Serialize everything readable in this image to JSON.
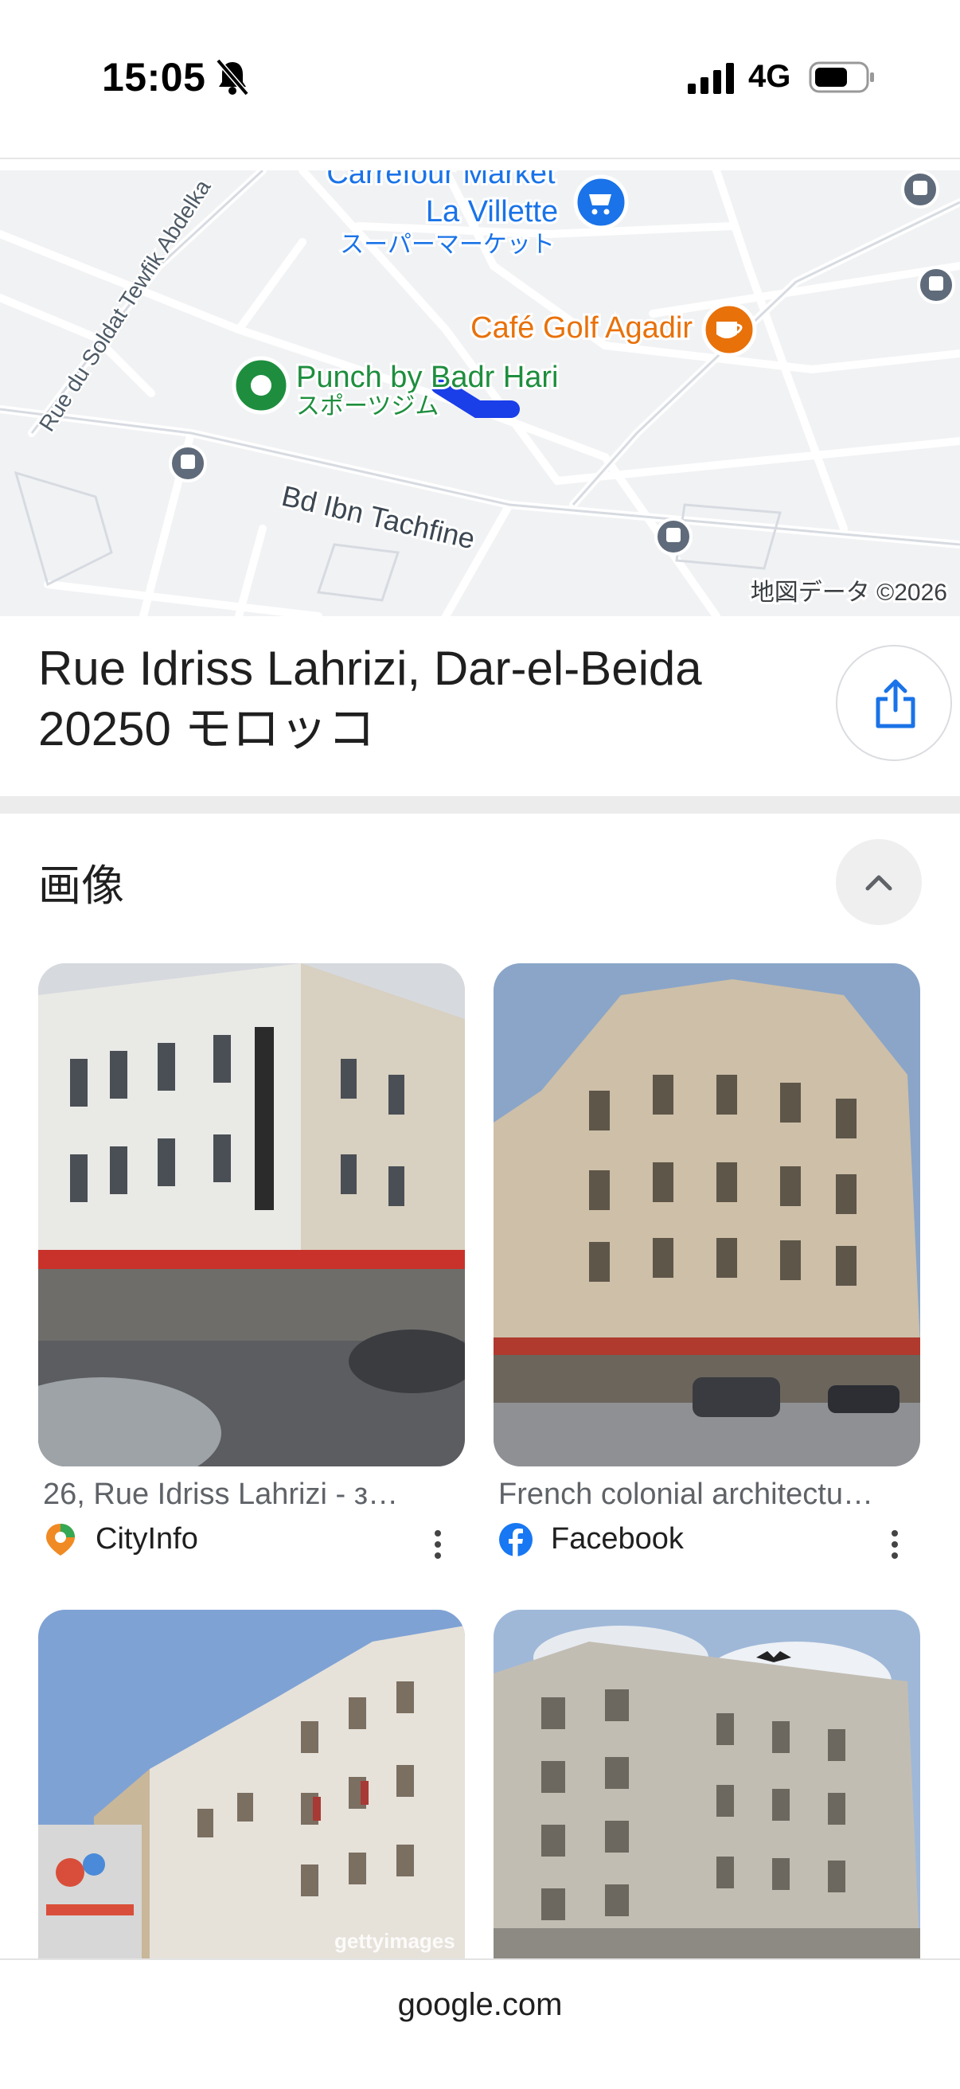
{
  "status_bar": {
    "time": "15:05",
    "network": "4G",
    "icons": [
      "bell-slash-icon",
      "cellular-signal-icon",
      "battery-icon"
    ]
  },
  "map": {
    "labels": {
      "carrefour_line1": "Carrefour Market",
      "carrefour_line2": "La Villette",
      "carrefour_category": "スーパーマーケット",
      "cafe": "Café Golf Agadir",
      "punch": "Punch by Badr Hari",
      "punch_category": "スポーツジム",
      "street_tewfik": "Rue du Soldat Tewfik Abdelka",
      "street_tachfine": "Bd Ibn Tachfine",
      "copyright": "地図データ ©2026"
    },
    "colors": {
      "poi_blue": "#1a73e8",
      "poi_orange": "#e8710a",
      "poi_green": "#1e8e3e",
      "route": "#1a3ee8"
    }
  },
  "place": {
    "address_line1": "Rue Idriss Lahrizi, Dar-el-Beida",
    "address_line2": "20250 モロッコ"
  },
  "images_section": {
    "heading": "画像",
    "items": [
      {
        "caption": "26, Rue Idriss Lahrizi - з…",
        "source": "CityInfo",
        "icon": "cityinfo-pin-icon"
      },
      {
        "caption": "French colonial architectu…",
        "source": "Facebook",
        "icon": "facebook-icon"
      },
      {
        "caption": "",
        "source": "",
        "watermark": "gettyimages"
      },
      {
        "caption": "",
        "source": ""
      }
    ]
  },
  "browser": {
    "url": "google.com"
  }
}
